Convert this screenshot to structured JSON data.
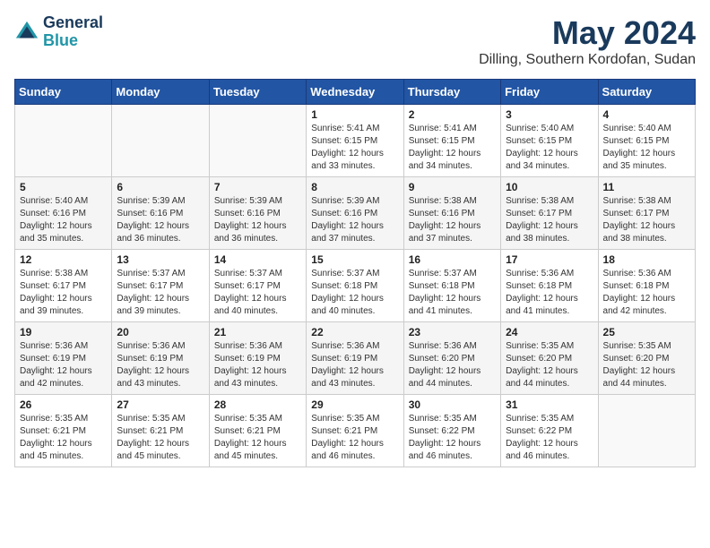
{
  "header": {
    "logo_line1": "General",
    "logo_line2": "Blue",
    "month": "May 2024",
    "location": "Dilling, Southern Kordofan, Sudan"
  },
  "weekdays": [
    "Sunday",
    "Monday",
    "Tuesday",
    "Wednesday",
    "Thursday",
    "Friday",
    "Saturday"
  ],
  "weeks": [
    [
      {
        "day": "",
        "info": ""
      },
      {
        "day": "",
        "info": ""
      },
      {
        "day": "",
        "info": ""
      },
      {
        "day": "1",
        "info": "Sunrise: 5:41 AM\nSunset: 6:15 PM\nDaylight: 12 hours\nand 33 minutes."
      },
      {
        "day": "2",
        "info": "Sunrise: 5:41 AM\nSunset: 6:15 PM\nDaylight: 12 hours\nand 34 minutes."
      },
      {
        "day": "3",
        "info": "Sunrise: 5:40 AM\nSunset: 6:15 PM\nDaylight: 12 hours\nand 34 minutes."
      },
      {
        "day": "4",
        "info": "Sunrise: 5:40 AM\nSunset: 6:15 PM\nDaylight: 12 hours\nand 35 minutes."
      }
    ],
    [
      {
        "day": "5",
        "info": "Sunrise: 5:40 AM\nSunset: 6:16 PM\nDaylight: 12 hours\nand 35 minutes."
      },
      {
        "day": "6",
        "info": "Sunrise: 5:39 AM\nSunset: 6:16 PM\nDaylight: 12 hours\nand 36 minutes."
      },
      {
        "day": "7",
        "info": "Sunrise: 5:39 AM\nSunset: 6:16 PM\nDaylight: 12 hours\nand 36 minutes."
      },
      {
        "day": "8",
        "info": "Sunrise: 5:39 AM\nSunset: 6:16 PM\nDaylight: 12 hours\nand 37 minutes."
      },
      {
        "day": "9",
        "info": "Sunrise: 5:38 AM\nSunset: 6:16 PM\nDaylight: 12 hours\nand 37 minutes."
      },
      {
        "day": "10",
        "info": "Sunrise: 5:38 AM\nSunset: 6:17 PM\nDaylight: 12 hours\nand 38 minutes."
      },
      {
        "day": "11",
        "info": "Sunrise: 5:38 AM\nSunset: 6:17 PM\nDaylight: 12 hours\nand 38 minutes."
      }
    ],
    [
      {
        "day": "12",
        "info": "Sunrise: 5:38 AM\nSunset: 6:17 PM\nDaylight: 12 hours\nand 39 minutes."
      },
      {
        "day": "13",
        "info": "Sunrise: 5:37 AM\nSunset: 6:17 PM\nDaylight: 12 hours\nand 39 minutes."
      },
      {
        "day": "14",
        "info": "Sunrise: 5:37 AM\nSunset: 6:17 PM\nDaylight: 12 hours\nand 40 minutes."
      },
      {
        "day": "15",
        "info": "Sunrise: 5:37 AM\nSunset: 6:18 PM\nDaylight: 12 hours\nand 40 minutes."
      },
      {
        "day": "16",
        "info": "Sunrise: 5:37 AM\nSunset: 6:18 PM\nDaylight: 12 hours\nand 41 minutes."
      },
      {
        "day": "17",
        "info": "Sunrise: 5:36 AM\nSunset: 6:18 PM\nDaylight: 12 hours\nand 41 minutes."
      },
      {
        "day": "18",
        "info": "Sunrise: 5:36 AM\nSunset: 6:18 PM\nDaylight: 12 hours\nand 42 minutes."
      }
    ],
    [
      {
        "day": "19",
        "info": "Sunrise: 5:36 AM\nSunset: 6:19 PM\nDaylight: 12 hours\nand 42 minutes."
      },
      {
        "day": "20",
        "info": "Sunrise: 5:36 AM\nSunset: 6:19 PM\nDaylight: 12 hours\nand 43 minutes."
      },
      {
        "day": "21",
        "info": "Sunrise: 5:36 AM\nSunset: 6:19 PM\nDaylight: 12 hours\nand 43 minutes."
      },
      {
        "day": "22",
        "info": "Sunrise: 5:36 AM\nSunset: 6:19 PM\nDaylight: 12 hours\nand 43 minutes."
      },
      {
        "day": "23",
        "info": "Sunrise: 5:36 AM\nSunset: 6:20 PM\nDaylight: 12 hours\nand 44 minutes."
      },
      {
        "day": "24",
        "info": "Sunrise: 5:35 AM\nSunset: 6:20 PM\nDaylight: 12 hours\nand 44 minutes."
      },
      {
        "day": "25",
        "info": "Sunrise: 5:35 AM\nSunset: 6:20 PM\nDaylight: 12 hours\nand 44 minutes."
      }
    ],
    [
      {
        "day": "26",
        "info": "Sunrise: 5:35 AM\nSunset: 6:21 PM\nDaylight: 12 hours\nand 45 minutes."
      },
      {
        "day": "27",
        "info": "Sunrise: 5:35 AM\nSunset: 6:21 PM\nDaylight: 12 hours\nand 45 minutes."
      },
      {
        "day": "28",
        "info": "Sunrise: 5:35 AM\nSunset: 6:21 PM\nDaylight: 12 hours\nand 45 minutes."
      },
      {
        "day": "29",
        "info": "Sunrise: 5:35 AM\nSunset: 6:21 PM\nDaylight: 12 hours\nand 46 minutes."
      },
      {
        "day": "30",
        "info": "Sunrise: 5:35 AM\nSunset: 6:22 PM\nDaylight: 12 hours\nand 46 minutes."
      },
      {
        "day": "31",
        "info": "Sunrise: 5:35 AM\nSunset: 6:22 PM\nDaylight: 12 hours\nand 46 minutes."
      },
      {
        "day": "",
        "info": ""
      }
    ]
  ]
}
